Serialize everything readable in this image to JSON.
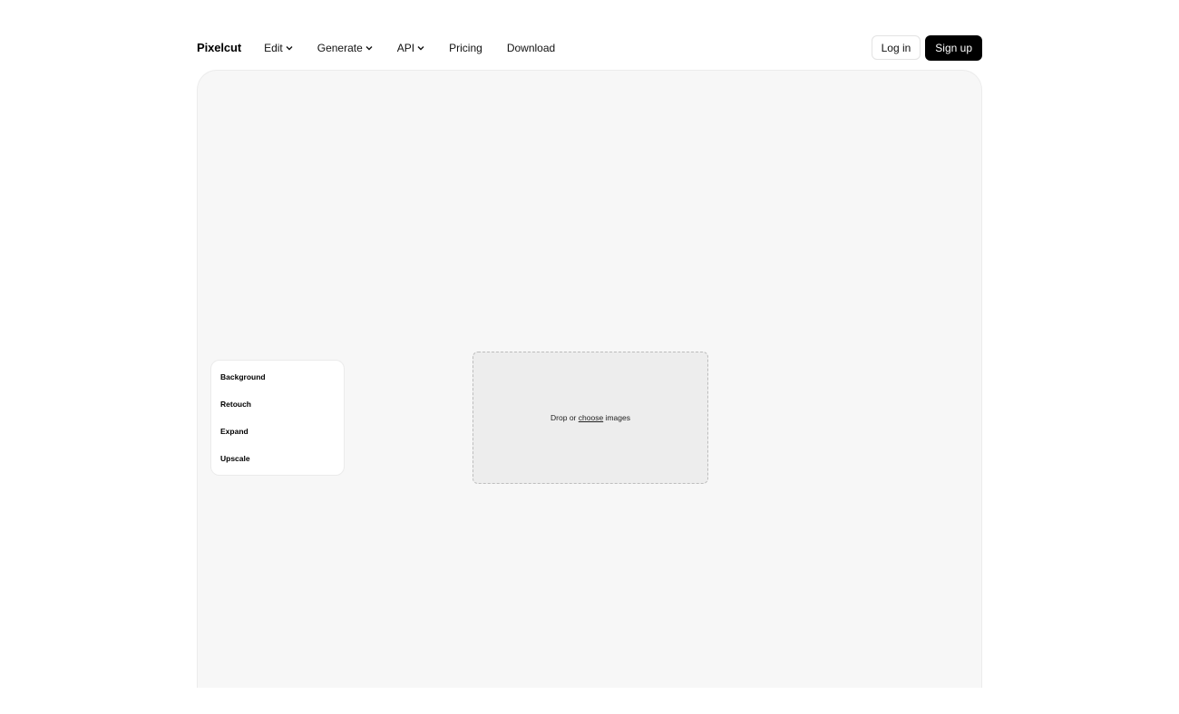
{
  "header": {
    "logo": "Pixelcut",
    "nav": [
      {
        "label": "Edit",
        "dropdown": true
      },
      {
        "label": "Generate",
        "dropdown": true
      },
      {
        "label": "API",
        "dropdown": true
      },
      {
        "label": "Pricing",
        "dropdown": false
      },
      {
        "label": "Download",
        "dropdown": false
      }
    ],
    "login_label": "Log in",
    "signup_label": "Sign up"
  },
  "tools": {
    "items": [
      "Background",
      "Retouch",
      "Expand",
      "Upscale"
    ]
  },
  "dropzone": {
    "prefix": "Drop or ",
    "link": "choose",
    "suffix": " images"
  },
  "icons": {
    "dropdown": "chevron-down-icon"
  },
  "colors": {
    "primary_button": "#000000",
    "workspace_bg": "#f7f7f7",
    "dropzone_bg": "#ededed"
  }
}
